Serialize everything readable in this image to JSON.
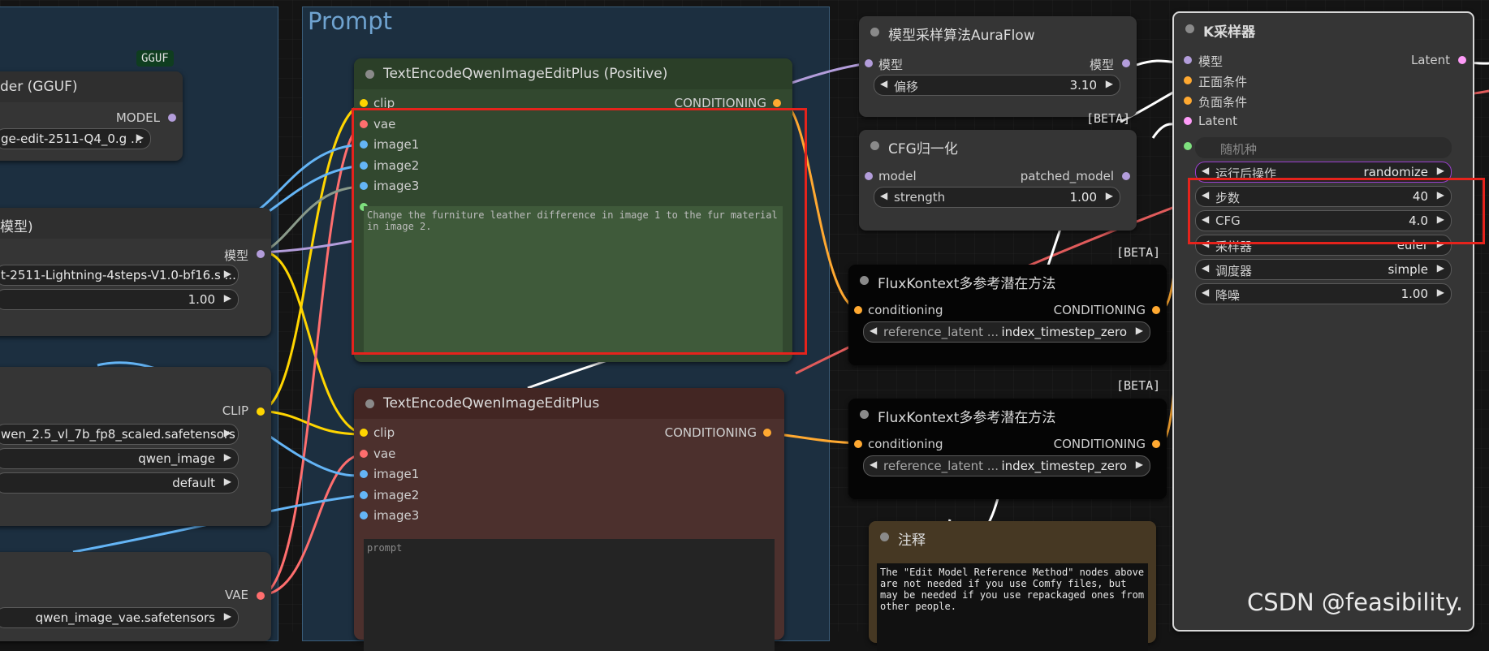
{
  "canvas": {
    "group_title": "Prompt",
    "watermark": "CSDN @feasibility."
  },
  "left_nodes": {
    "gguf_badge": "GGUF",
    "unet_loader": {
      "title": "der (GGUF)",
      "output": "MODEL",
      "unet_name": "ge-edit-2511-Q4_0.g ..."
    },
    "lora_loader": {
      "title": "模型)",
      "output": "模型",
      "lora_name": "t-2511-Lightning-4steps-V1.0-bf16.s ...",
      "strength": "1.00"
    },
    "clip_loader": {
      "output": "CLIP",
      "clip_name": "wen_2.5_vl_7b_fp8_scaled.safetensors",
      "type": "qwen_image",
      "device": "default"
    },
    "vae_loader": {
      "output": "VAE",
      "vae_name": "qwen_image_vae.safetensors"
    }
  },
  "positive_node": {
    "title": "TextEncodeQwenImageEditPlus (Positive)",
    "inputs": [
      "clip",
      "vae",
      "image1",
      "image2",
      "image3"
    ],
    "output": "CONDITIONING",
    "prompt_text": "Change the furniture leather difference in image 1 to the fur material in image 2."
  },
  "negative_node": {
    "title": "TextEncodeQwenImageEditPlus",
    "inputs": [
      "clip",
      "vae",
      "image1",
      "image2",
      "image3"
    ],
    "output": "CONDITIONING",
    "prompt_placeholder": "prompt"
  },
  "auraflow_node": {
    "title": "模型采样算法AuraFlow",
    "input": "模型",
    "output": "模型",
    "shift_label": "偏移",
    "shift_value": "3.10",
    "badge": "[BETA]"
  },
  "cfgnorm_node": {
    "title": "CFG归一化",
    "input": "model",
    "output": "patched_model",
    "strength_label": "strength",
    "strength_value": "1.00",
    "badge": "[BETA]"
  },
  "flux1_node": {
    "title": "FluxKontext多参考潜在方法",
    "input": "conditioning",
    "output": "CONDITIONING",
    "widget_label": "reference_latent ...",
    "widget_value": "index_timestep_zero",
    "badge": "[BETA]"
  },
  "flux2_node": {
    "title": "FluxKontext多参考潜在方法",
    "input": "conditioning",
    "output": "CONDITIONING",
    "widget_label": "reference_latent ...",
    "widget_value": "index_timestep_zero"
  },
  "note_node": {
    "title": "注释",
    "text": "The \"Edit Model Reference Method\" nodes above are not needed if you use Comfy files, but may be needed if you use repackaged ones from other people."
  },
  "ksampler": {
    "title": "K采样器",
    "inputs": [
      "模型",
      "正面条件",
      "负面条件",
      "Latent"
    ],
    "output": "Latent",
    "seed_label": "随机种",
    "widgets": [
      {
        "label": "运行后操作",
        "value": "randomize"
      },
      {
        "label": "步数",
        "value": "40"
      },
      {
        "label": "CFG",
        "value": "4.0"
      },
      {
        "label": "采样器",
        "value": "euler"
      },
      {
        "label": "调度器",
        "value": "simple"
      },
      {
        "label": "降噪",
        "value": "1.00"
      }
    ]
  },
  "colors": {
    "model": "#b39ddb",
    "clip": "#ffd500",
    "vae": "#ff6e6e",
    "image": "#64b5f6",
    "conditioning": "#ffa931",
    "latent": "#ff9cf9",
    "highlight": "#e5231c"
  }
}
